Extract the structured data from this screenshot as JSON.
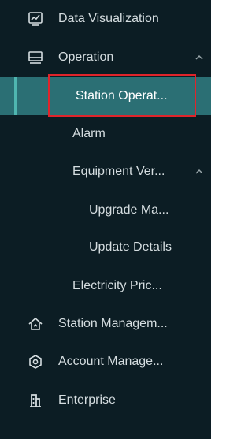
{
  "menu": {
    "data_visualization": {
      "label": "Data Visualization",
      "icon": "chart-board-icon"
    },
    "operation": {
      "label": "Operation",
      "icon": "monitor-icon",
      "expanded": true
    },
    "station_operation": {
      "label": "Station Operat...",
      "active": true
    },
    "alarm": {
      "label": "Alarm"
    },
    "equipment_version": {
      "label": "Equipment Ver...",
      "expanded": true
    },
    "upgrade_management": {
      "label": "Upgrade Ma..."
    },
    "update_details": {
      "label": "Update Details"
    },
    "electricity_price": {
      "label": "Electricity Pric..."
    },
    "station_management": {
      "label": "Station Managem...",
      "icon": "house-icon"
    },
    "account_management": {
      "label": "Account Manage...",
      "icon": "hexagon-eye-icon"
    },
    "enterprise": {
      "label": "Enterprise",
      "icon": "building-icon"
    }
  },
  "colors": {
    "sidebar_bg": "#0c1d24",
    "active_bg": "#2b6f74",
    "active_bar": "#4fb6b0",
    "text": "#d5dde0",
    "highlight_box": "#e0242b"
  }
}
